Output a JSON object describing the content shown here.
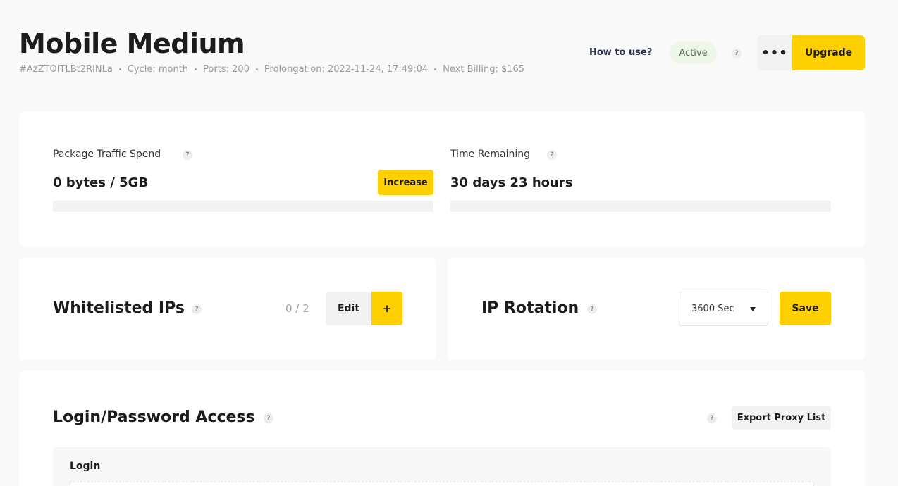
{
  "header": {
    "title": "Mobile Medium",
    "meta": [
      "#AzZTOITLBt2RINLa",
      "Cycle: month",
      "Ports: 200",
      "Prolongation: 2022-11-24, 17:49:04",
      "Next Billing: $165"
    ],
    "how_to_use": "How to use?",
    "status": "Active",
    "help": "?",
    "more": "•••",
    "upgrade": "Upgrade"
  },
  "traffic": {
    "label": "Package Traffic Spend",
    "value": "0 bytes / 5GB",
    "increase": "Increase",
    "progress": 0
  },
  "time": {
    "label": "Time Remaining",
    "value": "30 days 23 hours",
    "progress": 0
  },
  "whitelist": {
    "title": "Whitelisted IPs",
    "count": "0 / 2",
    "edit": "Edit",
    "add": "+"
  },
  "rotation": {
    "title": "IP Rotation",
    "selected": "3600 Sec",
    "save": "Save"
  },
  "access": {
    "title": "Login/Password Access",
    "export": "Export Proxy List",
    "column_login": "Login"
  },
  "colors": {
    "accent": "#ffd000",
    "background": "#f9f9fa",
    "card": "#ffffff",
    "status_bg": "#eef6ea"
  }
}
